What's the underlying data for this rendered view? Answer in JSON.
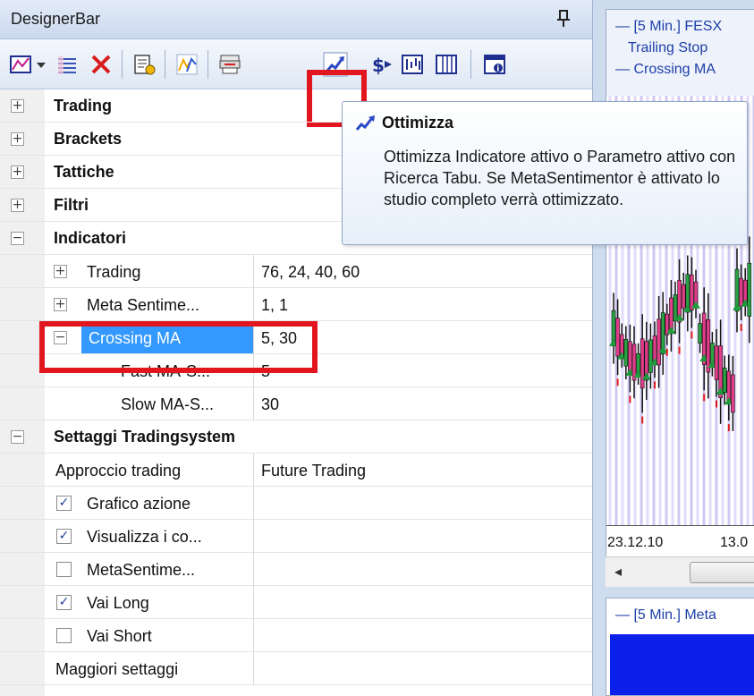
{
  "panel": {
    "title": "DesignerBar"
  },
  "toolbar": {
    "buttons": [
      "chart-icon",
      "dropdown-arrow-icon",
      "list-icon",
      "delete-icon",
      "report-icon",
      "indicator-icon",
      "print-icon",
      "optimize-icon",
      "dollar-signal-icon",
      "wave-chart-icon",
      "table-icon",
      "info-window-icon"
    ],
    "highlight_color": "#e2161f"
  },
  "tooltip": {
    "title": "Ottimizza",
    "body": "Ottimizza Indicatore attivo o Parametro attivo con Ricerca Tabu. Se MetaSentimentor è attivato lo studio completo verrà ottimizzato."
  },
  "tree": {
    "categories": {
      "trading": "Trading",
      "brackets": "Brackets",
      "tattiche": "Tattiche",
      "filtri": "Filtri",
      "indicatori": "Indicatori",
      "settaggi": "Settaggi Tradingsystem"
    },
    "indicators": {
      "trading": {
        "name": "Trading",
        "value": "76, 24, 40, 60"
      },
      "meta": {
        "name": "Meta Sentime...",
        "value": "1, 1"
      },
      "crossing": {
        "name": "Crossing MA",
        "value": "5, 30"
      },
      "fast": {
        "name": "Fast MA-S...",
        "value": "5"
      },
      "slow": {
        "name": "Slow MA-S...",
        "value": "30"
      }
    },
    "settings": {
      "approach": {
        "name": "Approccio trading",
        "value": "Future Trading"
      },
      "grafico": {
        "name": "Grafico azione",
        "checked": true
      },
      "visualizza": {
        "name": "Visualizza i co...",
        "checked": true
      },
      "metasentimentor": {
        "name": "MetaSentime...",
        "checked": false
      },
      "vai_long": {
        "name": "Vai Long",
        "checked": true
      },
      "vai_short": {
        "name": "Vai Short",
        "checked": false
      },
      "maggiori": {
        "name": "Maggiori settaggi"
      }
    }
  },
  "chart": {
    "legend": [
      "— [5 Min.] FESX",
      "Trailing Stop",
      "— Crossing MA"
    ],
    "x_ticks": [
      "23.12.10",
      "13.0"
    ],
    "bottom_legend": "— [5 Min.] Meta"
  }
}
